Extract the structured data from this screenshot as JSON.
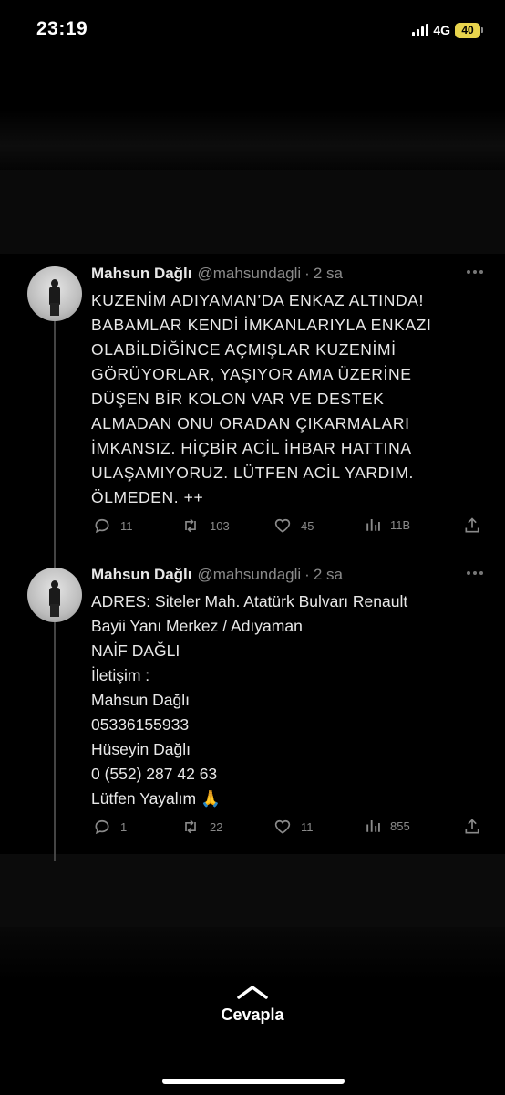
{
  "status_bar": {
    "time": "23:19",
    "network": "4G",
    "battery": "40",
    "battery_color": "#e8d44d"
  },
  "thread": {
    "tweets": [
      {
        "author_name": "Mahsun Dağlı",
        "author_handle": "@mahsundagli",
        "separator": "·",
        "time": "2 sa",
        "text_lines": [
          "KUZENİM ADIYAMAN’DA ENKAZ ALTINDA!",
          "BABAMLAR KENDİ İMKANLARIYLA ENKAZI",
          "OLABİLDİĞİNCE AÇMIŞLAR KUZENİMİ",
          "GÖRÜYORLAR, YAŞIYOR AMA ÜZERİNE",
          "DÜŞEN BİR KOLON VAR VE DESTEK",
          "ALMADAN ONU ORADAN ÇIKARMALARI",
          "İMKANSIZ. HİÇBİR ACİL İHBAR HATTINA",
          "ULAŞAMIYORUZ. LÜTFEN ACİL YARDIM.",
          "ÖLMEDEN. ++"
        ],
        "replies": "11",
        "retweets": "103",
        "likes": "45",
        "views": "11B"
      },
      {
        "author_name": "Mahsun Dağlı",
        "author_handle": "@mahsundagli",
        "separator": "·",
        "time": "2 sa",
        "text_lines": [
          "ADRES: Siteler Mah. Atatürk Bulvarı Renault",
          "Bayii Yanı Merkez / Adıyaman",
          "NAİF DAĞLI",
          "İletişim :",
          "Mahsun Dağlı",
          "05336155933",
          "Hüseyin Dağlı",
          "0 (552) 287 42 63",
          "Lütfen Yayalım 🙏"
        ],
        "replies": "1",
        "retweets": "22",
        "likes": "11",
        "views": "855"
      }
    ]
  },
  "reply_bar": {
    "label": "Cevapla",
    "icon": "chevron-up-icon"
  },
  "colors": {
    "background": "#000000",
    "text": "#e8e8e8",
    "muted": "#8a8a8a"
  }
}
